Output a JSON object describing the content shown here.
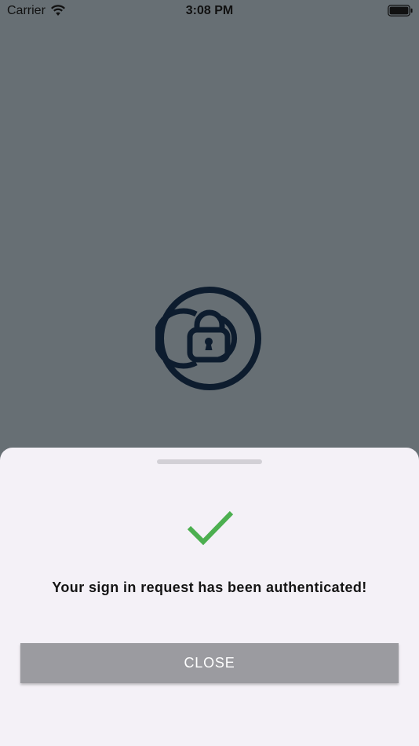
{
  "status_bar": {
    "carrier": "Carrier",
    "time": "3:08 PM",
    "wifi_icon": "wifi-icon",
    "battery_icon": "battery-icon"
  },
  "logo": {
    "icon": "lock-emblem-icon",
    "color": "#0d1c2e"
  },
  "sheet": {
    "check_icon": "checkmark-icon",
    "check_color": "#4caf50",
    "message": "Your sign in request has been authenticated!",
    "close_label": "CLOSE"
  },
  "colors": {
    "backdrop": "#676f74",
    "sheet_background": "#f4f1f7",
    "button_background": "#9b9ba0"
  }
}
